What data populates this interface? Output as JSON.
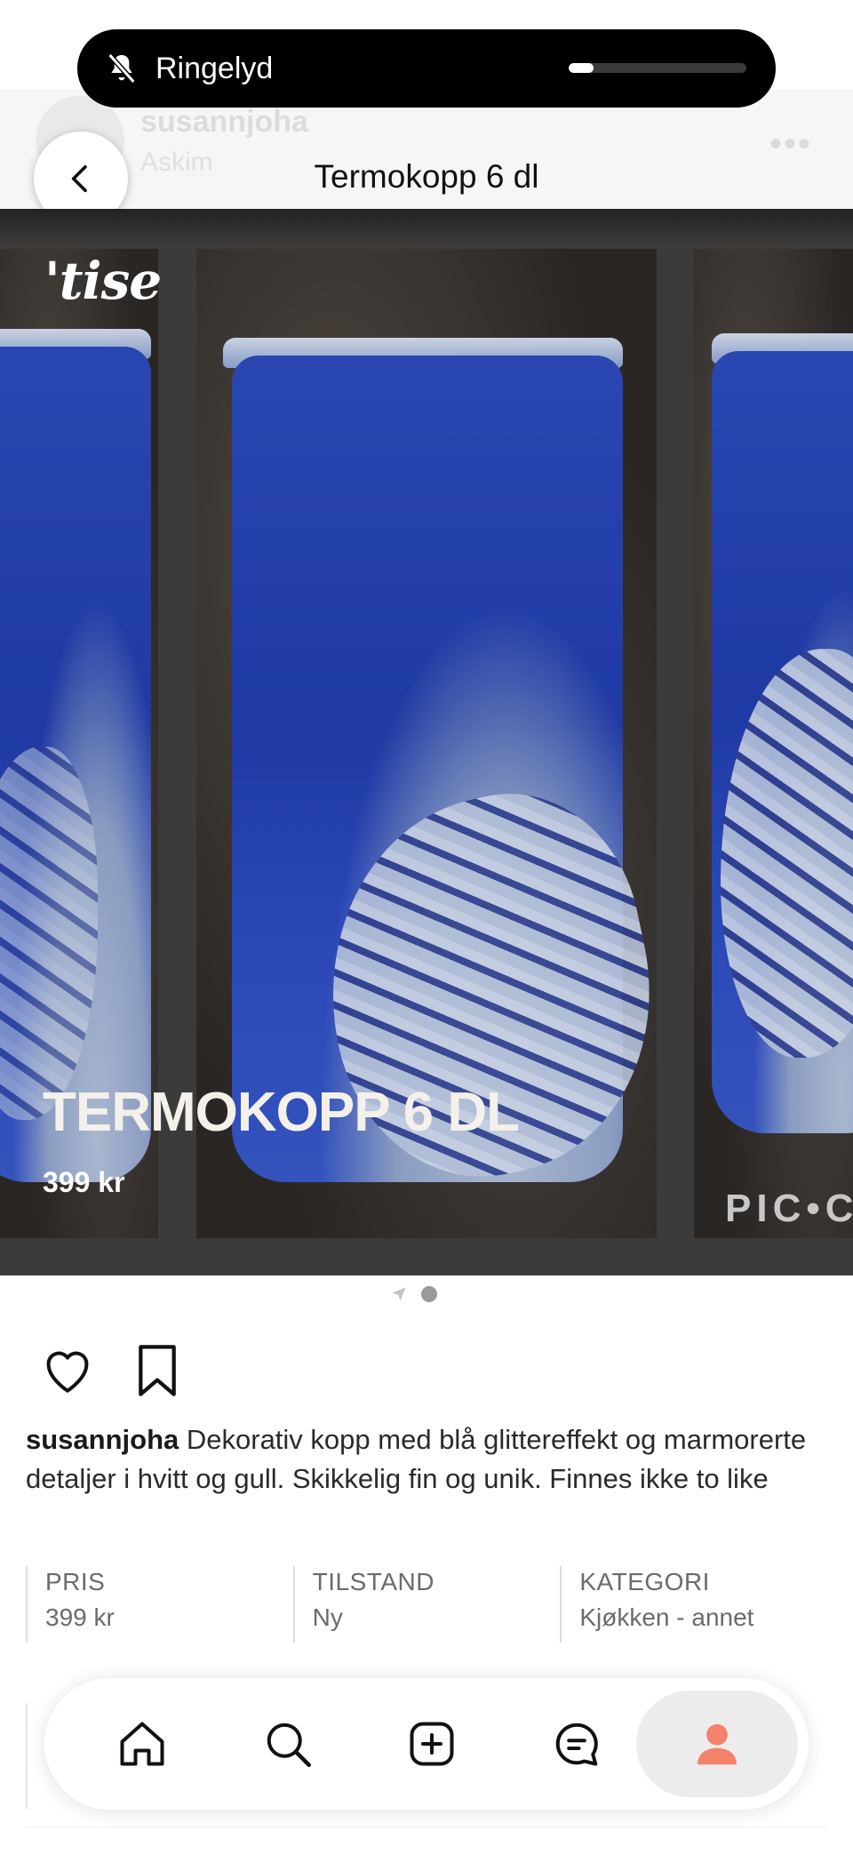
{
  "status": {
    "ringer_label": "Ringelyd",
    "volume_level": 0.14
  },
  "background_header": {
    "username": "susannjoha",
    "location": "Askim",
    "more_label": "•••"
  },
  "header": {
    "title": "Termokopp 6 dl"
  },
  "gallery": {
    "logo_text": "'tise",
    "overlay_title": "TERMOKOPP 6 DL",
    "overlay_price": "399 kr",
    "watermark": "PIC•C",
    "page_count": 1,
    "current_page": 1
  },
  "post": {
    "username": "susannjoha",
    "description": " Dekorativ kopp med blå glittereffekt og marmorerte detaljer i hvitt og gull. Skikkelig fin og unik. Finnes ikke to like"
  },
  "specs": [
    {
      "label": "PRIS",
      "value": "399 kr"
    },
    {
      "label": "TILSTAND",
      "value": "Ny"
    },
    {
      "label": "KATEGORI",
      "value": "Kjøkken - annet"
    }
  ],
  "nav": {
    "items": [
      "home-icon",
      "search-icon",
      "add-icon",
      "chat-icon",
      "profile-icon"
    ],
    "active": "profile-icon",
    "accent": "#f4826a"
  }
}
